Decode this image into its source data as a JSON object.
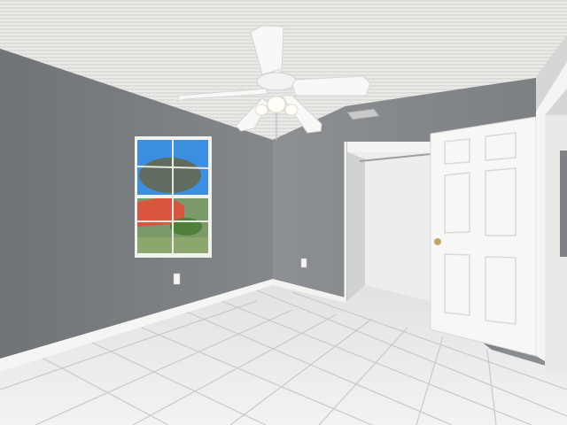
{
  "scene": {
    "room_type": "empty bedroom",
    "colors": {
      "wall": "#7f8285",
      "wall_light": "#8c8f92",
      "ceiling": "#e9e9e7",
      "floor": "#ebeced",
      "grout": "#c9cbcd",
      "trim": "#f5f5f3",
      "door": "#f7f7f6",
      "sky": "#3b8fe0",
      "tree": "#5f6c5e",
      "house": "#d9553d",
      "palm": "#4f7f3a"
    },
    "objects": [
      "ceiling-fan",
      "window",
      "closet",
      "open-door",
      "tile-floor",
      "baseboard",
      "outlets",
      "vent"
    ]
  }
}
